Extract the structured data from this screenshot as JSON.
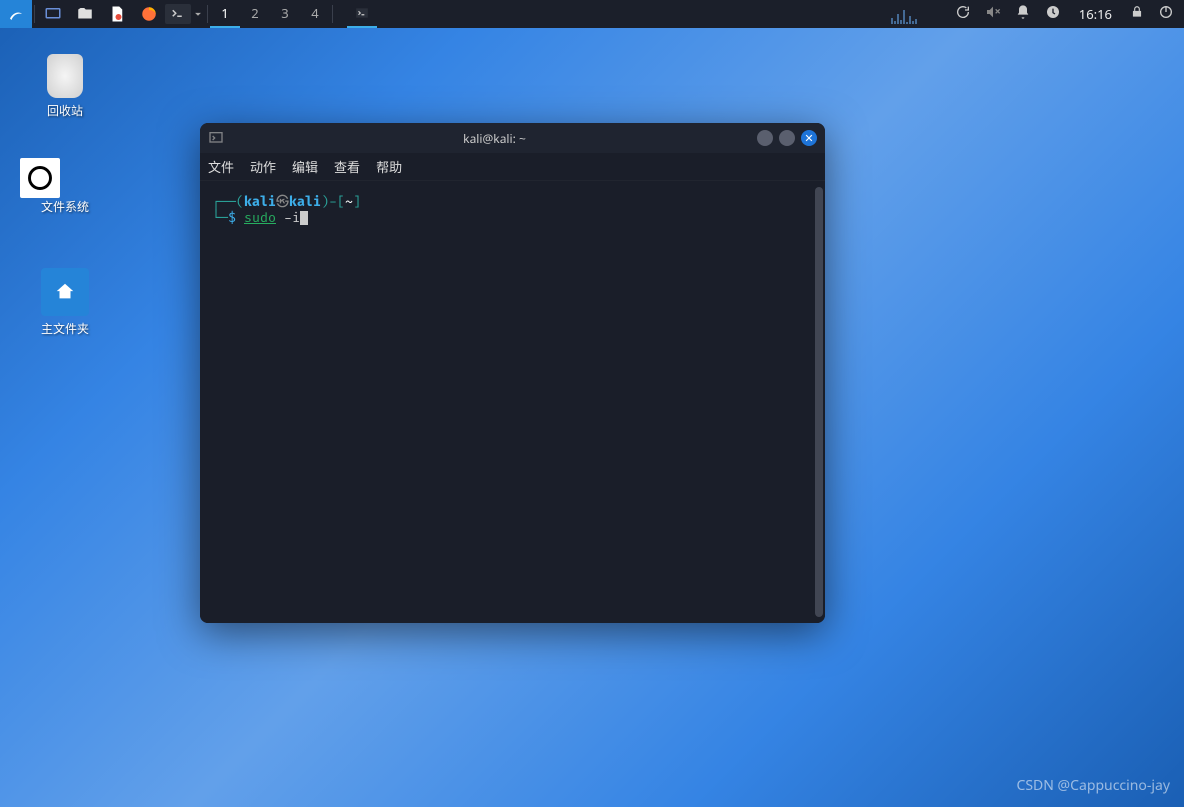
{
  "panel": {
    "workspaces": [
      "1",
      "2",
      "3",
      "4"
    ],
    "active_workspace": 0,
    "clock": "16:16"
  },
  "desktop_icons": {
    "trash": "回收站",
    "filesystem": "文件系统",
    "home": "主文件夹"
  },
  "terminal": {
    "title": "kali@kali: ~",
    "menu": {
      "file": "文件",
      "actions": "动作",
      "edit": "编辑",
      "view": "查看",
      "help": "帮助"
    },
    "prompt": {
      "open_paren": "┌──(",
      "user": "kali",
      "at": "㉿",
      "host": "kali",
      "close_paren": ")-[",
      "path": "~",
      "close_bracket": "]",
      "line2_prefix": "└─",
      "dollar": "$",
      "command": "sudo",
      "args": "-i"
    }
  },
  "watermark": "CSDN @Cappuccino-jay"
}
